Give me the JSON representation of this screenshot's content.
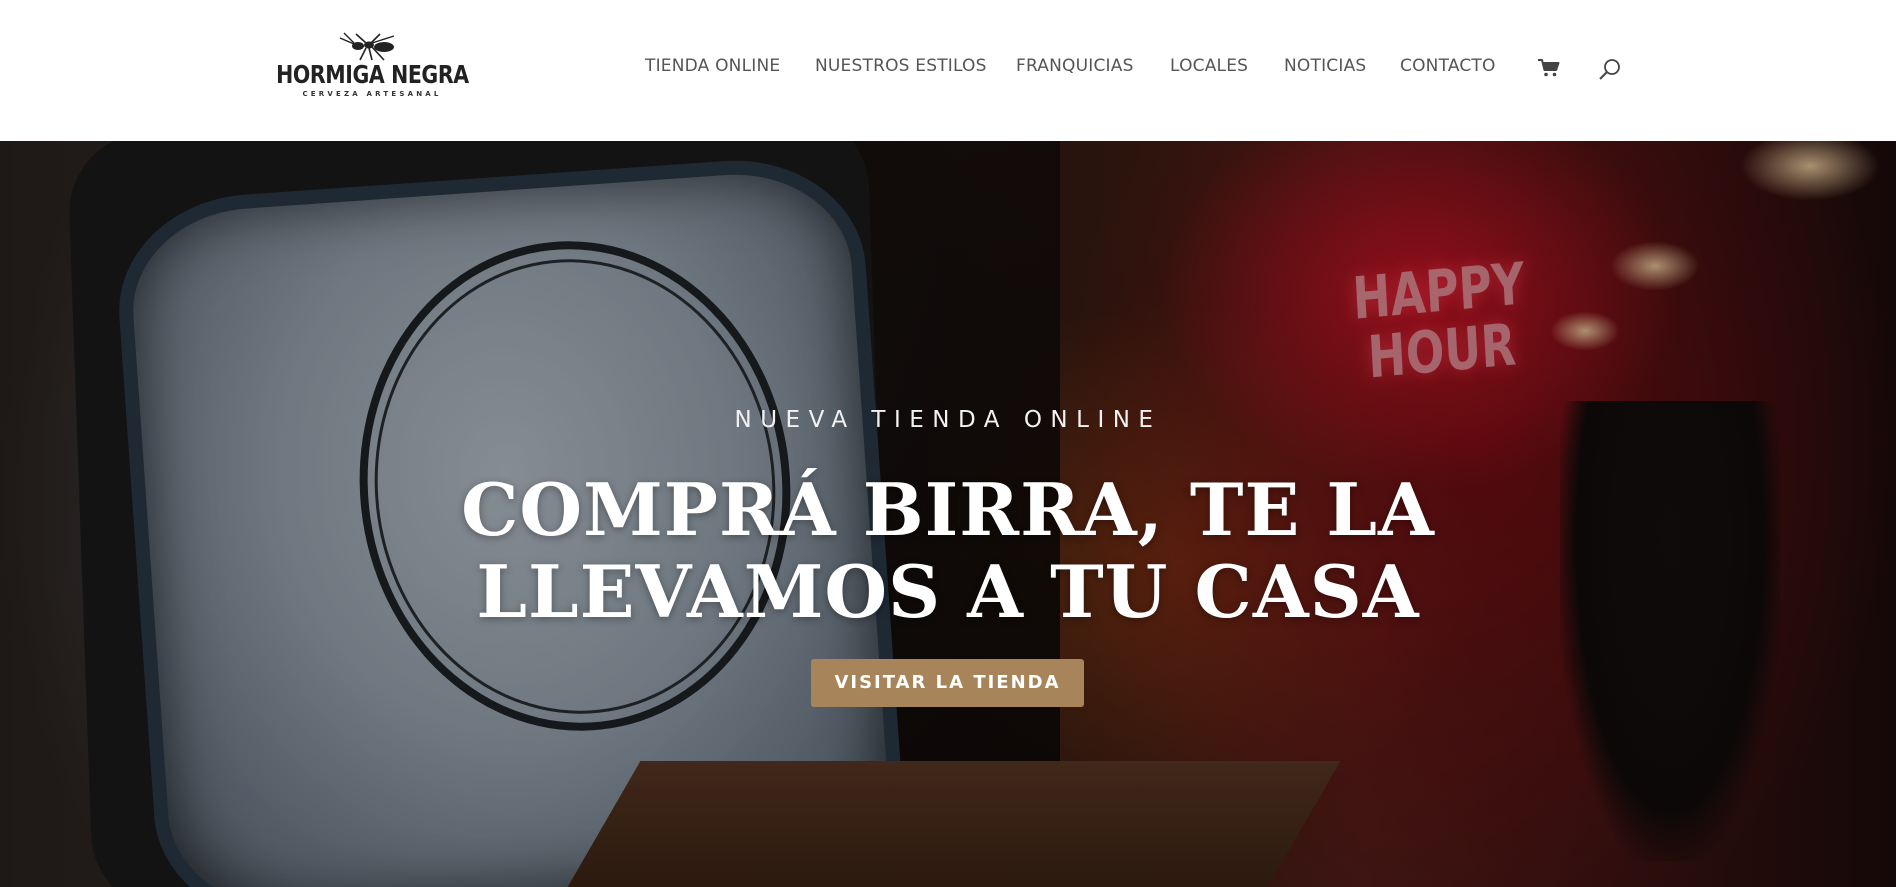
{
  "brand": {
    "name": "HORMIGA NEGRA",
    "tagline": "CERVEZA ARTESANAL",
    "logo_icon": "ant-icon"
  },
  "nav": {
    "items": [
      {
        "label": "TIENDA ONLINE"
      },
      {
        "label": "NUESTROS ESTILOS"
      },
      {
        "label": "FRANQUICIAS"
      },
      {
        "label": "LOCALES"
      },
      {
        "label": "NOTICIAS"
      },
      {
        "label": "CONTACTO"
      }
    ],
    "cart_icon": "cart-icon",
    "search_icon": "search-icon"
  },
  "hero": {
    "eyebrow": "NUEVA TIENDA ONLINE",
    "title_line1": "COMPRÁ BIRRA, TE LA",
    "title_line2": "LLEVAMOS A TU CASA",
    "cta_label": "VISITAR LA TIENDA",
    "neon_line1": "HAPPY",
    "neon_line2": "HOUR"
  },
  "colors": {
    "accent": "#a8845a",
    "nav_text": "#555555",
    "header_bg": "#ffffff"
  }
}
